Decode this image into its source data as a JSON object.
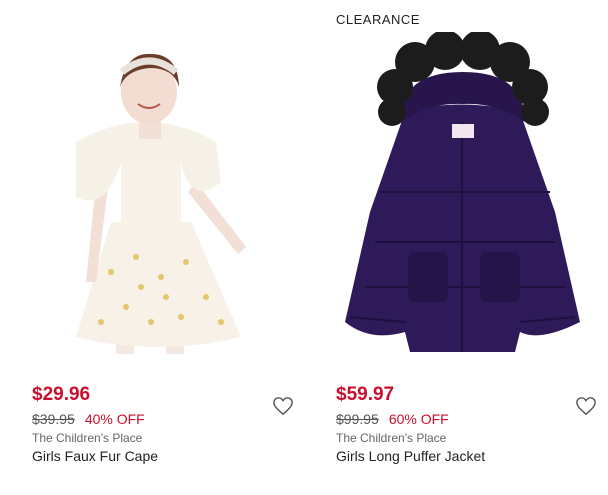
{
  "products": [
    {
      "badge": "",
      "price": "$29.96",
      "was_price": "$39.95",
      "discount": "40% OFF",
      "brand": "The Children's Place",
      "name": "Girls Faux Fur Cape",
      "favorite_icon": "heart-outline-icon",
      "image": "girl-white-cape-dress-photo"
    },
    {
      "badge": "CLEARANCE",
      "price": "$59.97",
      "was_price": "$99.95",
      "discount": "60% OFF",
      "brand": "The Children's Place",
      "name": "Girls Long Puffer Jacket",
      "favorite_icon": "heart-outline-icon",
      "image": "purple-puffer-jacket-photo"
    }
  ],
  "colors": {
    "sale_red": "#c8102e",
    "jacket_purple": "#2a1550"
  }
}
